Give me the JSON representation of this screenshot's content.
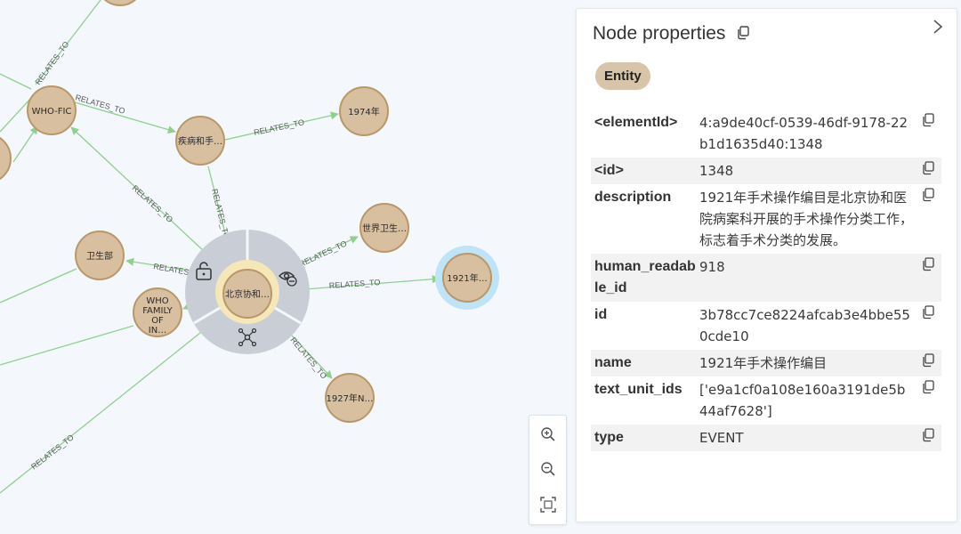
{
  "graph": {
    "edge_label": "RELATES_TO",
    "nodes": {
      "who_fic": "WHO-FIC",
      "disease": "疾病和手…",
      "y1974": "1974年",
      "world_health": "世界卫生…",
      "y1921": "1921年…",
      "health_ministry": "卫生部",
      "who_family_1": "WHO",
      "who_family_2": "FAMILY",
      "who_family_3": "OF",
      "who_family_4": "IN…",
      "pumc": "北京协和…",
      "y1927": "1927年N…"
    },
    "ring_menu_icons": [
      "unlock-icon",
      "hide-icon",
      "expand-graph-icon"
    ]
  },
  "zoom_controls": {
    "icons": [
      "zoom-in-icon",
      "zoom-out-icon",
      "fit-screen-icon"
    ]
  },
  "panel": {
    "title": "Node properties",
    "badge": "Entity",
    "properties": [
      {
        "key": "<elementId>",
        "value": "4:a9de40cf-0539-46df-9178-22b1d1635d40:1348"
      },
      {
        "key": "<id>",
        "value": "1348"
      },
      {
        "key": "description",
        "value": "1921年手术操作编目是北京协和医院病案科开展的手术操作分类工作，标志着手术分类的发展。"
      },
      {
        "key": "human_readable_id",
        "value": "918"
      },
      {
        "key": "id",
        "value": "3b78cc7ce8224afcab3e4bbe550cde10"
      },
      {
        "key": "name",
        "value": "1921年手术操作编目"
      },
      {
        "key": "text_unit_ids",
        "value": "['e9a1cf0a108e160a3191de5b44af7628']"
      },
      {
        "key": "type",
        "value": "EVENT"
      }
    ]
  },
  "colors": {
    "background": "#f4f8fc",
    "node_fill": "#d8bf9f",
    "node_stroke": "#b89869",
    "edge": "#8fd08f",
    "selected_halo": "#bfe3f7",
    "badge": "#d8c4a8"
  }
}
